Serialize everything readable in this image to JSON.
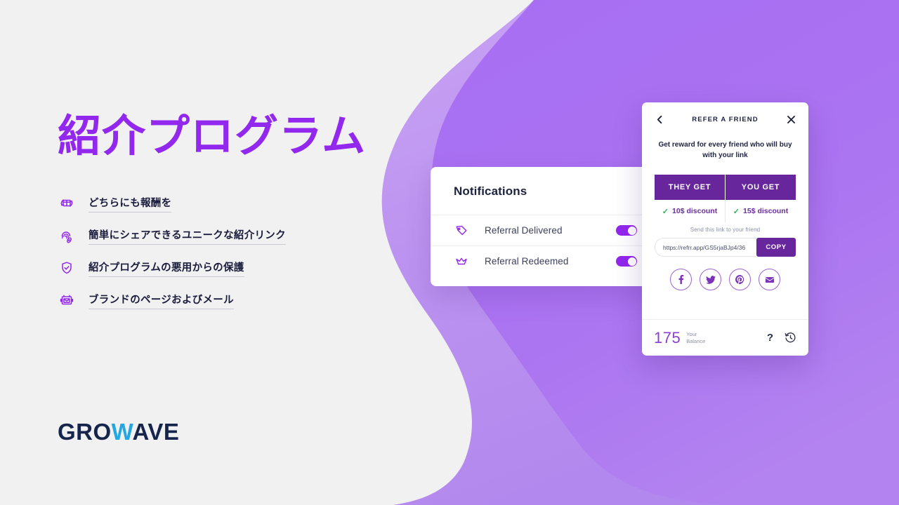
{
  "page": {
    "background_color": "#F1F1F2",
    "accent_purple": "#9227EE",
    "wave_light": "#BC93F0",
    "wave_dark": "#A970F2",
    "deep_purple": "#67269B"
  },
  "hero": {
    "headline": "紹介プログラム",
    "features": [
      {
        "icon": "gift-refresh-icon",
        "label": "どちらにも報酬を"
      },
      {
        "icon": "fingerprint-link-icon",
        "label": "簡単にシェアできるユニークな紹介リンク"
      },
      {
        "icon": "shield-check-icon",
        "label": "紹介プログラムの悪用からの保護"
      },
      {
        "icon": "branded-email-icon",
        "label": "ブランドのページおよびメール"
      }
    ]
  },
  "logo": {
    "part1": "GRO",
    "part2": "W",
    "part3": "AVE",
    "accent_color": "#25A8E0",
    "base_color": "#16254C"
  },
  "notifications_card": {
    "title": "Notifications",
    "rows": [
      {
        "icon": "tag-icon",
        "label": "Referral Delivered",
        "toggle_on": true
      },
      {
        "icon": "crown-icon",
        "label": "Referral Redeemed",
        "toggle_on": true
      }
    ]
  },
  "refer_modal": {
    "back_icon": "chevron-left-icon",
    "title": "REFER A FRIEND",
    "close_icon": "close-icon",
    "subtitle": "Get reward for every friend who will buy with your link",
    "tabs": [
      {
        "label": "THEY GET"
      },
      {
        "label": "YOU GET"
      }
    ],
    "discounts": [
      {
        "check": "✓",
        "label": "10$ discount"
      },
      {
        "check": "✓",
        "label": "15$ discount"
      }
    ],
    "send_hint": "Send this link to your friend",
    "link_value": "https://refrr.app/GS5rjaBJp4/36",
    "copy_label": "COPY",
    "socials": [
      {
        "icon": "facebook-icon"
      },
      {
        "icon": "twitter-icon"
      },
      {
        "icon": "pinterest-icon"
      },
      {
        "icon": "email-icon"
      }
    ],
    "balance_value": "175",
    "balance_label_line1": "Your",
    "balance_label_line2": "Balance",
    "help_label": "?",
    "history_icon": "history-clock-icon"
  }
}
